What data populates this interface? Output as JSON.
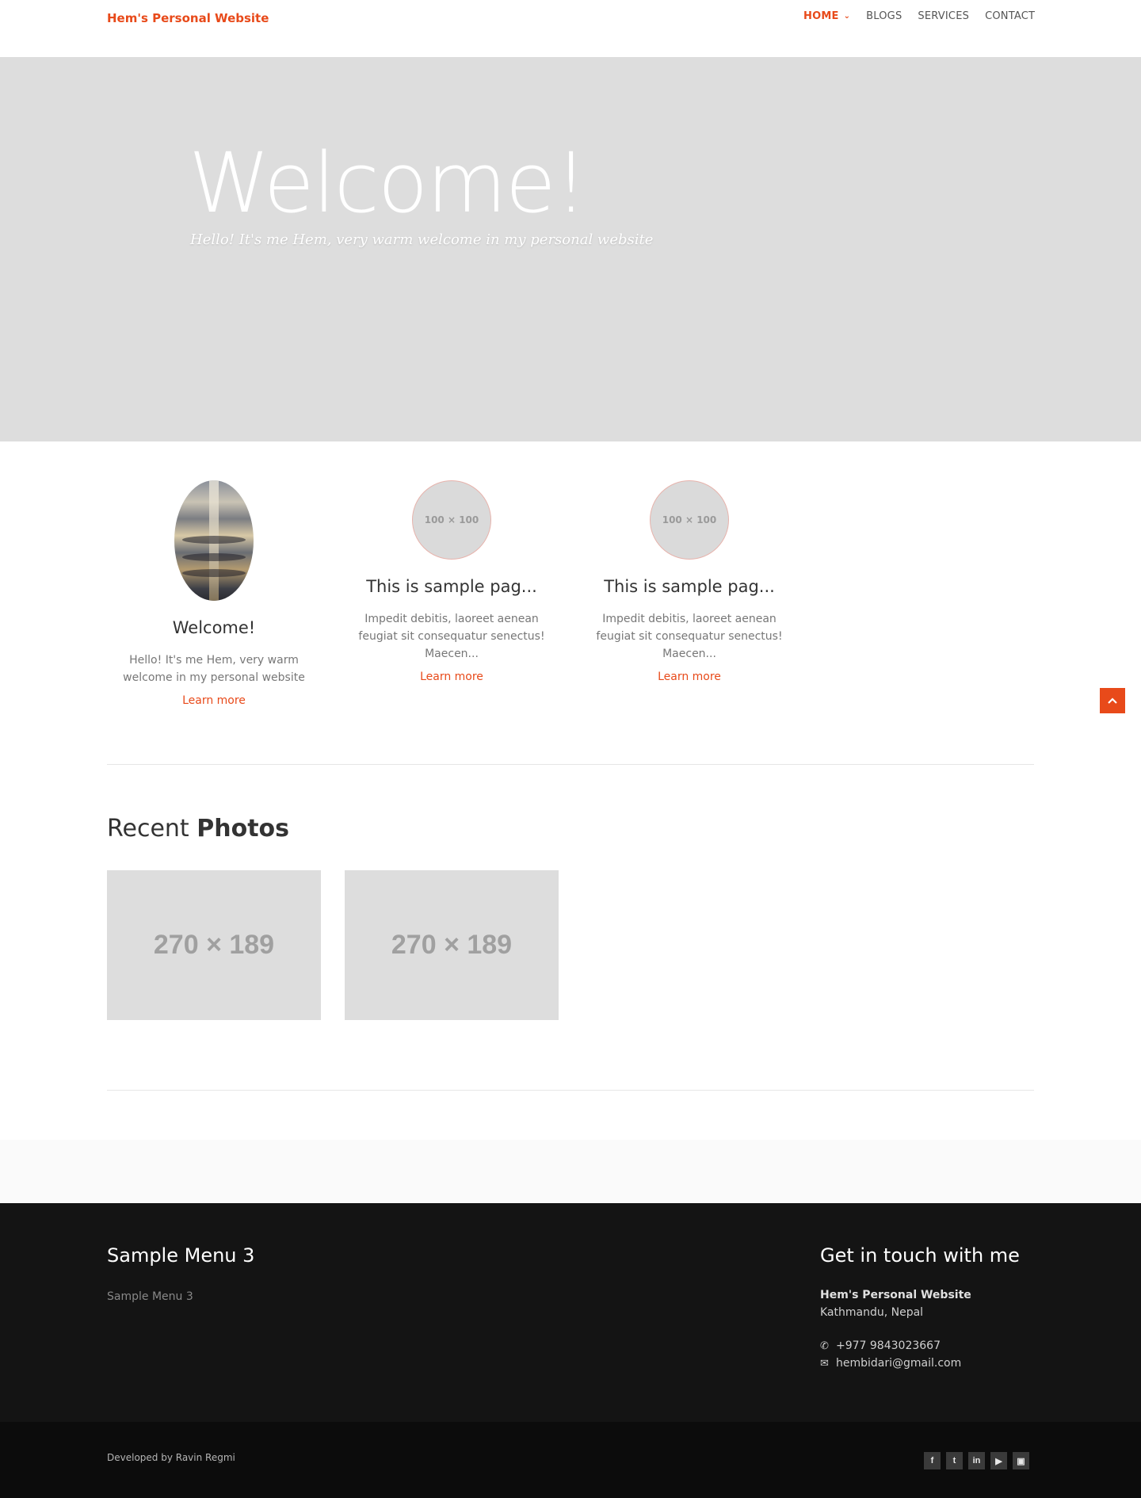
{
  "header": {
    "brand": "Hem's Personal Website",
    "nav": [
      {
        "label": "HOME",
        "active": true
      },
      {
        "label": "BLOGS"
      },
      {
        "label": "SERVICES"
      },
      {
        "label": "CONTACT"
      }
    ],
    "accent_color": "#e84a1a"
  },
  "hero": {
    "title": "Welcome!",
    "subtitle": "Hello! It's me Hem, very warm welcome in my personal website"
  },
  "features": [
    {
      "image": "oval-photo",
      "title": "Welcome!",
      "text": "Hello! It's me Hem, very warm welcome in my personal website",
      "link": "Learn more"
    },
    {
      "image_label": "100 × 100",
      "title": "This is sample pag...",
      "text": "Impedit debitis, laoreet aenean feugiat sit consequatur senectus! Maecen...",
      "link": "Learn more"
    },
    {
      "image_label": "100 × 100",
      "title": "This is sample pag...",
      "text": "Impedit debitis, laoreet aenean feugiat sit consequatur senectus! Maecen...",
      "link": "Learn more"
    }
  ],
  "recent": {
    "title_light": "Recent",
    "title_bold": "Photos",
    "photos": [
      "270 × 189",
      "270 × 189"
    ]
  },
  "footer": {
    "menu_heading": "Sample Menu 3",
    "menu_link": "Sample Menu 3",
    "contact_heading": "Get in touch with me",
    "contact_name": "Hem's Personal Website",
    "contact_location": "Kathmandu, Nepal",
    "phone": "+977 9843023667",
    "email": "hembidari@gmail.com",
    "developed_by": "Developed by Ravin Regmi",
    "social": [
      "f",
      "t",
      "in",
      "yt",
      "ig"
    ]
  },
  "icons": {
    "chevron": "chevron-down-icon",
    "scroll_top": "chevron-up-icon",
    "phone": "phone-icon",
    "email": "envelope-icon"
  }
}
